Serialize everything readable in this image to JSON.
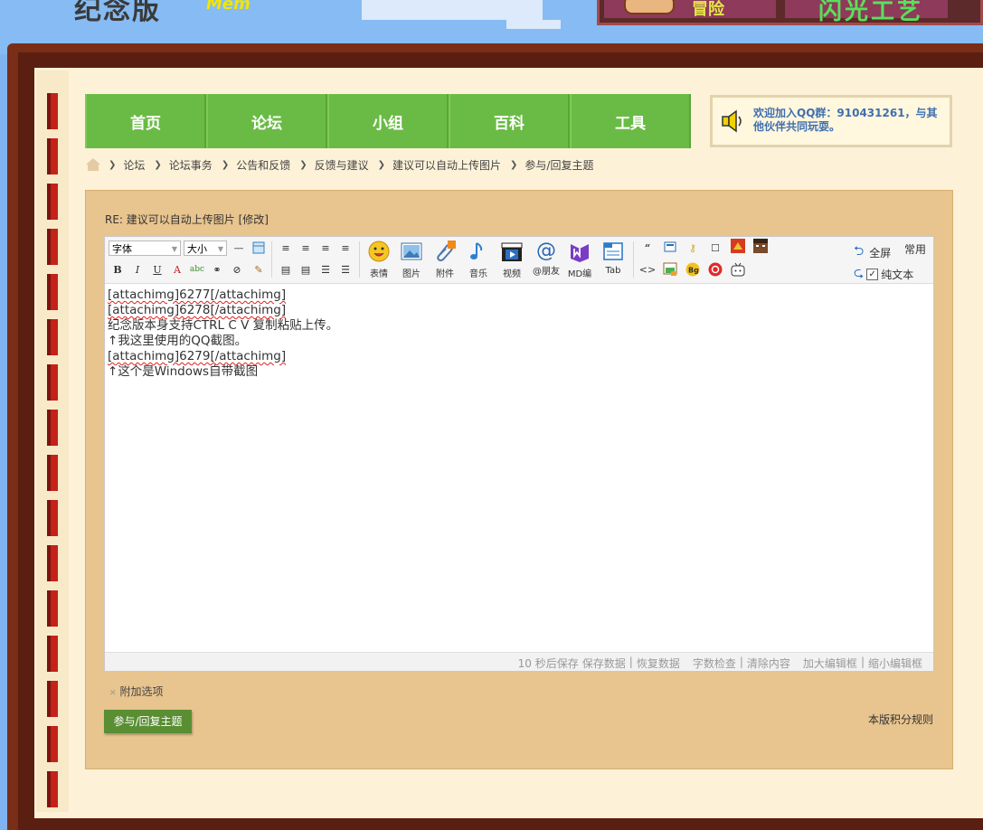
{
  "banner": {
    "logo": "纪念版",
    "logo_sub": "Mem",
    "sign_left": "冒险",
    "sign_right": "闪光工艺"
  },
  "nav": {
    "items": [
      "首页",
      "论坛",
      "小组",
      "百科",
      "工具"
    ]
  },
  "qq": {
    "text": "欢迎加入QQ群：910431261，与其他伙伴共同玩耍。"
  },
  "breadcrumb": [
    "论坛",
    "论坛事务",
    "公告和反馈",
    "反馈与建议",
    "建议可以自动上传图片",
    "参与/回复主题"
  ],
  "reply_title": "RE: 建议可以自动上传图片 [修改]",
  "toolbar": {
    "font_select": "字体",
    "size_select": "大小",
    "buttons": {
      "emoji": "表情",
      "image": "图片",
      "attach": "附件",
      "music": "音乐",
      "video": "视频",
      "at": "@朋友",
      "md": "MD编",
      "tab": "Tab"
    },
    "fullscreen": "全屏",
    "common": "常用",
    "plaintext": "纯文本"
  },
  "content": {
    "lines": [
      "[attachimg]6277[/attachimg]",
      "[attachimg]6278[/attachimg]",
      "纪念版本身支持CTRL C V 复制粘贴上传。",
      "↑我这里使用的QQ截图。",
      "[attachimg]6279[/attachimg]",
      "↑这个是Windows自带截图"
    ]
  },
  "status": {
    "autosave": "10 秒后保存",
    "save": "保存数据",
    "restore": "恢复数据",
    "count": "字数检查",
    "clear": "清除内容",
    "enlarge": "加大编辑框",
    "shrink": "缩小编辑框",
    "divider": "|"
  },
  "options_label": "附加选项",
  "reply_button": "参与/回复主题",
  "rules_link": "本版积分规则",
  "colors": {
    "nav_green": "#6abb45",
    "panel": "#e8c48e",
    "button_green": "#5a8e33",
    "frame": "#7a2e17"
  }
}
